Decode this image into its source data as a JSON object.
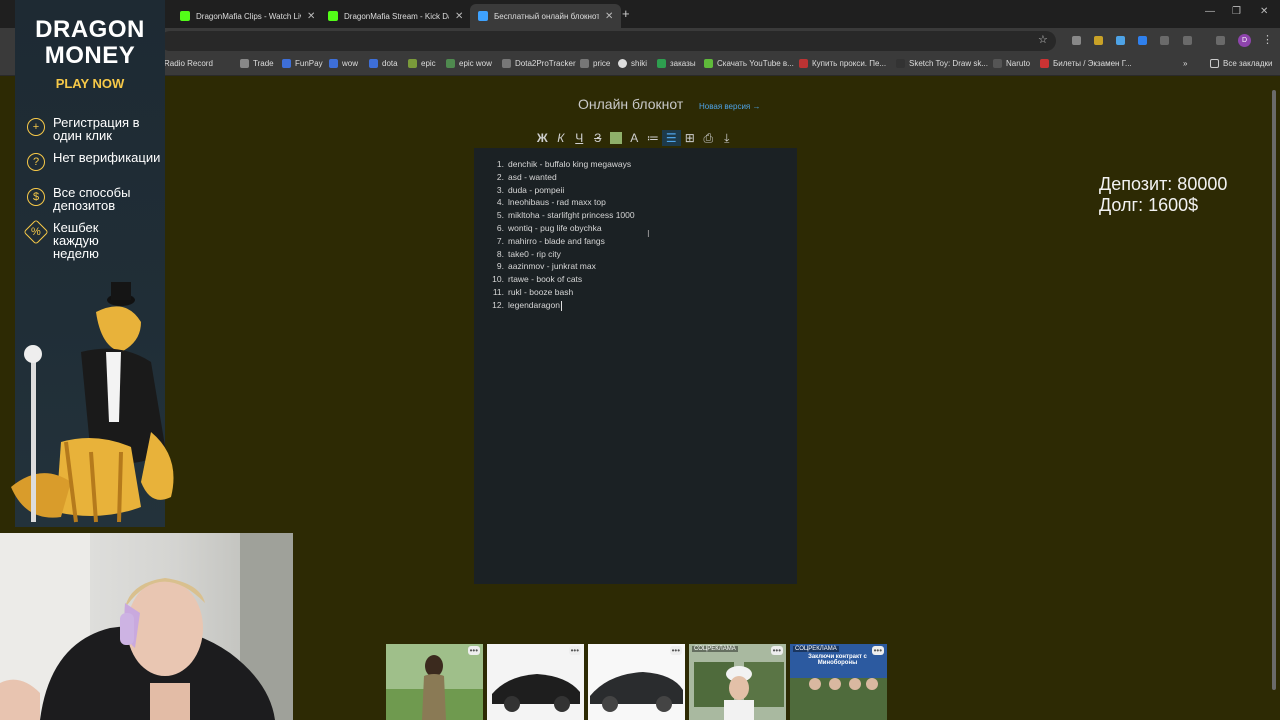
{
  "browser": {
    "tabs": [
      {
        "title": "DragonMafia Clips - Watch Live"
      },
      {
        "title": "DragonMafia Stream - Kick Da"
      },
      {
        "title": "Бесплатный онлайн блокнот д"
      }
    ],
    "bookmarks": [
      "Radio Record",
      "Trade",
      "FunPay",
      "wow",
      "dota",
      "epic",
      "epic wow",
      "Dota2ProTracker",
      "price",
      "shiki",
      "заказы",
      "Скачать YouTube в...",
      "Купить прокси. Пе...",
      "Sketch Toy: Draw sk...",
      "Naruto",
      "Билеты / Экзамен Г..."
    ],
    "all_bookmarks": "Все закладки",
    "profile_initial": "D"
  },
  "page": {
    "title": "Онлайн блокнот",
    "new_version": "Новая версия →",
    "toolbar": [
      "Ж",
      "К",
      "Ч",
      "З",
      "",
      "A",
      "≔",
      "☰",
      "⊞",
      "⎙",
      "⤓"
    ]
  },
  "notepad": {
    "lines": [
      {
        "n": "1.",
        "text": "denchik - buffalo king megaways"
      },
      {
        "n": "2.",
        "text": "asd - wanted"
      },
      {
        "n": "3.",
        "text": "duda - pompeii"
      },
      {
        "n": "4.",
        "text": "lneohibaus - rad maxx top"
      },
      {
        "n": "5.",
        "text": "mikltoha - starlifght princess 1000"
      },
      {
        "n": "6.",
        "text": "wontiq - pug life obychka"
      },
      {
        "n": "7.",
        "text": "mahirro - blade and fangs"
      },
      {
        "n": "8.",
        "text": "take0 - rip city"
      },
      {
        "n": "9.",
        "text": "aazinmov - junkrat max"
      },
      {
        "n": "10.",
        "text": "rtawe - book of cats"
      },
      {
        "n": "11.",
        "text": "rukl - booze bash"
      },
      {
        "n": "12.",
        "text": "legendaragon"
      }
    ]
  },
  "overlay": {
    "deposit": "Депозит: 80000",
    "debt": "Долг: 1600$"
  },
  "ad": {
    "logo_line1": "DRAGON",
    "logo_line2": "MONEY",
    "cta": "PLAY NOW",
    "features": [
      "Регистрация в один клик",
      "Нет верификации",
      "Все способы депозитов",
      "Кешбек каждую неделю"
    ]
  },
  "thumbnails": {
    "tag1": "СОЦРЕКЛАМА",
    "tag2": "СОЦРЕКЛАМА",
    "caption": "Заключи контракт с Минобороны"
  },
  "colors": {
    "accent": "#f7c948",
    "page_bg": "#2d2a04",
    "editor_bg": "#1b2124",
    "link": "#4ea3e6"
  }
}
